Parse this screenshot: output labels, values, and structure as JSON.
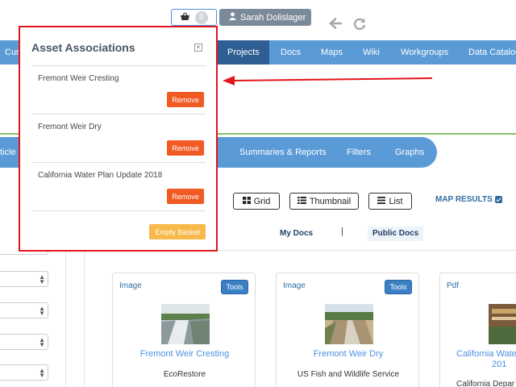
{
  "header": {
    "basket_count": "0",
    "user_name": "Sarah Dolislager"
  },
  "main_nav": {
    "items": [
      "Cur",
      "Projects",
      "Docs",
      "Maps",
      "Wiki",
      "Workgroups",
      "Data Catalog"
    ],
    "active": "Projects"
  },
  "sub_nav": {
    "items": [
      "ticle",
      "Summaries & Reports",
      "Filters",
      "Graphs"
    ]
  },
  "view_options": {
    "grid": "Grid",
    "thumbnail": "Thumbnail",
    "list": "List",
    "map_results": "MAP RESULTS"
  },
  "doc_tabs": {
    "my_docs": "My Docs",
    "separator": "|",
    "public_docs": "Public Docs"
  },
  "cards": [
    {
      "type": "Image",
      "tools": "Tools",
      "title": "Fremont Weir Cresting",
      "org": "EcoRestore"
    },
    {
      "type": "Image",
      "tools": "Tools",
      "title": "Fremont Weir Dry",
      "org": "US Fish and Wildlife Service"
    },
    {
      "type": "Pdf",
      "title": "California Wate",
      "title2": "201",
      "org": "California Depar"
    }
  ],
  "popup": {
    "title": "Asset Associations",
    "items": [
      {
        "name": "Fremont Weir Cresting",
        "action": "Remove"
      },
      {
        "name": "Fremont Weir Dry",
        "action": "Remove"
      },
      {
        "name": "California Water Plan Update 2018",
        "action": "Remove"
      }
    ],
    "empty_label": "Empty Basket"
  },
  "colors": {
    "nav_blue": "#5a9ad6",
    "nav_active": "#2e5e93",
    "remove_orange": "#f05a23",
    "empty_yellow": "#f6b94a",
    "highlight_red": "#e4141b"
  }
}
